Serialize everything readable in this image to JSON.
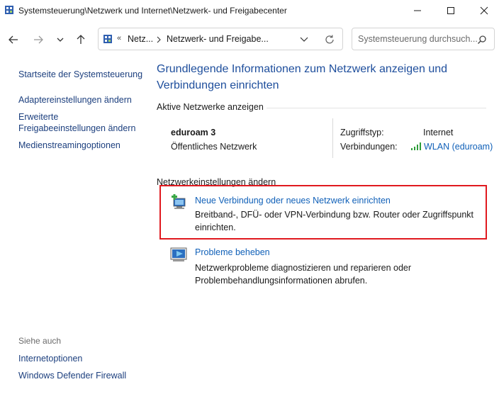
{
  "window": {
    "title": "Systemsteuerung\\Netzwerk und Internet\\Netzwerk- und Freigabecenter"
  },
  "nav": {
    "breadcrumb_overflow": "«",
    "breadcrumb": [
      "Netz...",
      "Netzwerk- und Freigabe..."
    ],
    "search_placeholder": "Systemsteuerung durchsuch..."
  },
  "sidebar": {
    "home_link": "Startseite der Systemsteuerung",
    "links": [
      "Adaptereinstellungen ändern",
      "Erweiterte Freigabeeinstellungen ändern",
      "Medienstreamingoptionen"
    ],
    "see_also_title": "Siehe auch",
    "see_also": [
      "Internetoptionen",
      "Windows Defender Firewall"
    ]
  },
  "main": {
    "title": "Grundlegende Informationen zum Netzwerk anzeigen und Verbindungen einrichten",
    "active_networks_header": "Aktive Netzwerke anzeigen",
    "network": {
      "name": "eduroam 3",
      "type": "Öffentliches Netzwerk",
      "access_label": "Zugriffstyp:",
      "access_value": "Internet",
      "connections_label": "Verbindungen:",
      "connections_value": "WLAN (eduroam)"
    },
    "change_settings_header": "Netzwerkeinstellungen ändern",
    "tasks": [
      {
        "title": "Neue Verbindung oder neues Netzwerk einrichten",
        "description": "Breitband-, DFÜ- oder VPN-Verbindung bzw. Router oder Zugriffspunkt einrichten."
      },
      {
        "title": "Probleme beheben",
        "description": "Netzwerkprobleme diagnostizieren und reparieren oder Problembehandlungsinformationen abrufen."
      }
    ]
  },
  "colors": {
    "title_blue": "#1e4e9c",
    "link_blue": "#1060b8",
    "highlight_red": "#e0191f",
    "signal_green": "#2e9e3a"
  }
}
